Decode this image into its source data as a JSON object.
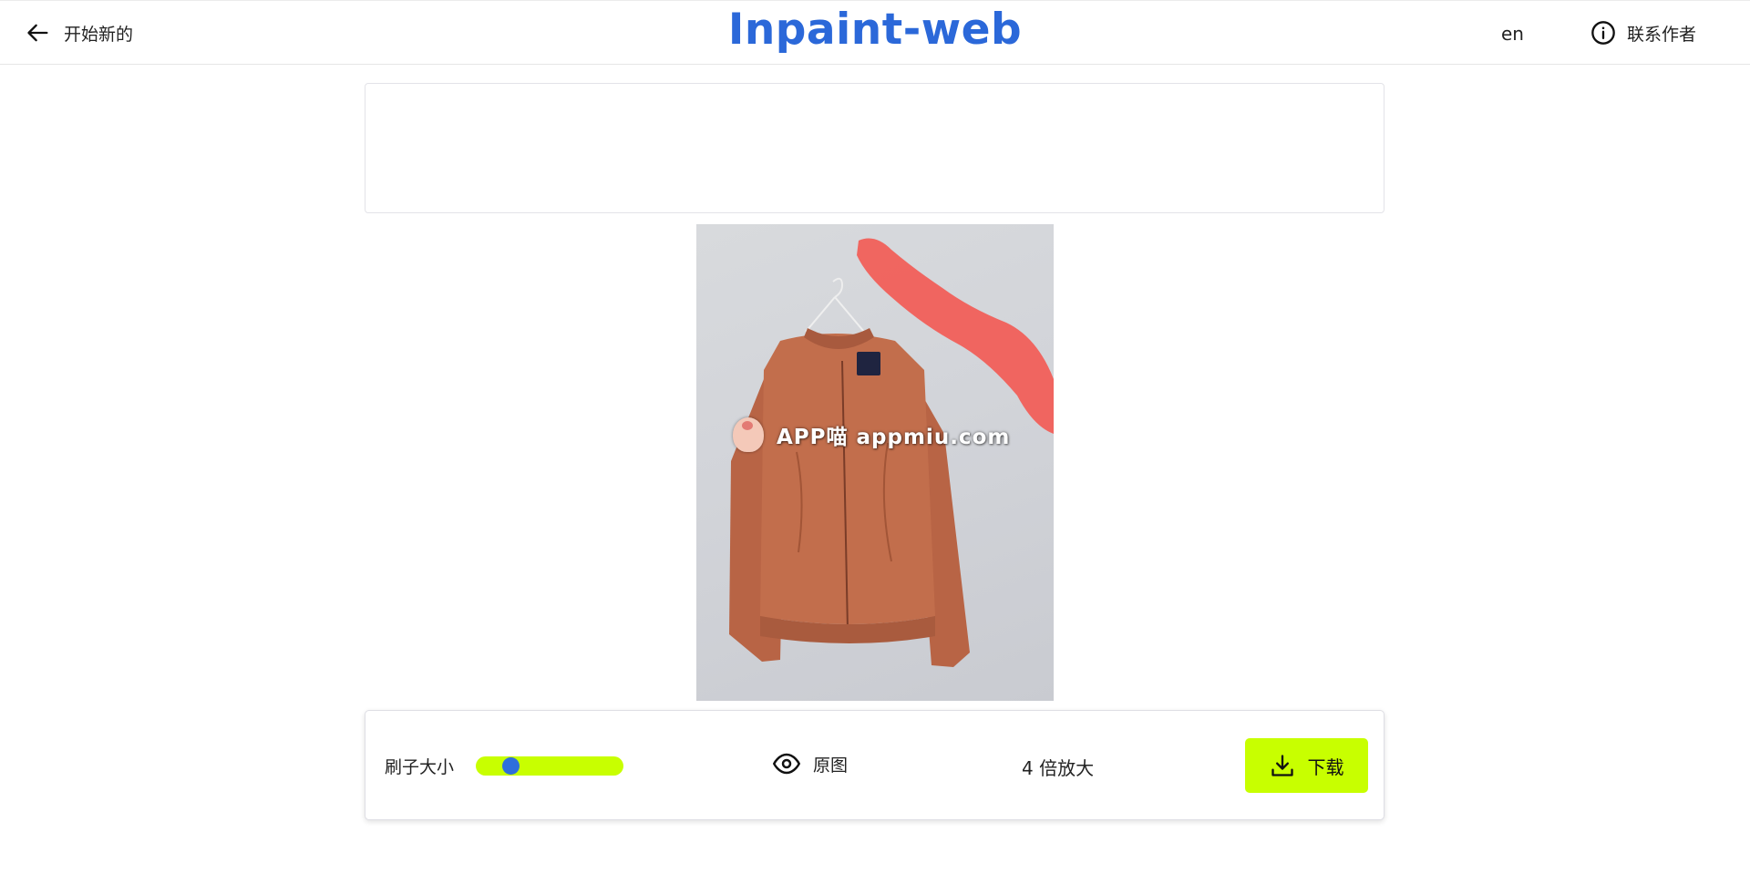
{
  "header": {
    "back_label": "开始新的",
    "title": "Inpaint-web",
    "lang": "en",
    "contact_label": "联系作者"
  },
  "canvas": {
    "watermark_text": "APP喵  appmiu.com",
    "mask_color": "#f4554e",
    "jacket_color": "#c26e4c"
  },
  "toolbar": {
    "brush_label": "刷子大小",
    "brush_level": 0.2,
    "original_label": "原图",
    "upscale_label": "4 倍放大",
    "download_label": "下载"
  },
  "colors": {
    "title": "#2b68d9",
    "accent": "#c8ff00",
    "slider_thumb": "#2f6fdb"
  },
  "icons": {
    "back": "arrow-left-icon",
    "contact": "info-icon",
    "original": "eye-icon",
    "download": "download-icon"
  }
}
